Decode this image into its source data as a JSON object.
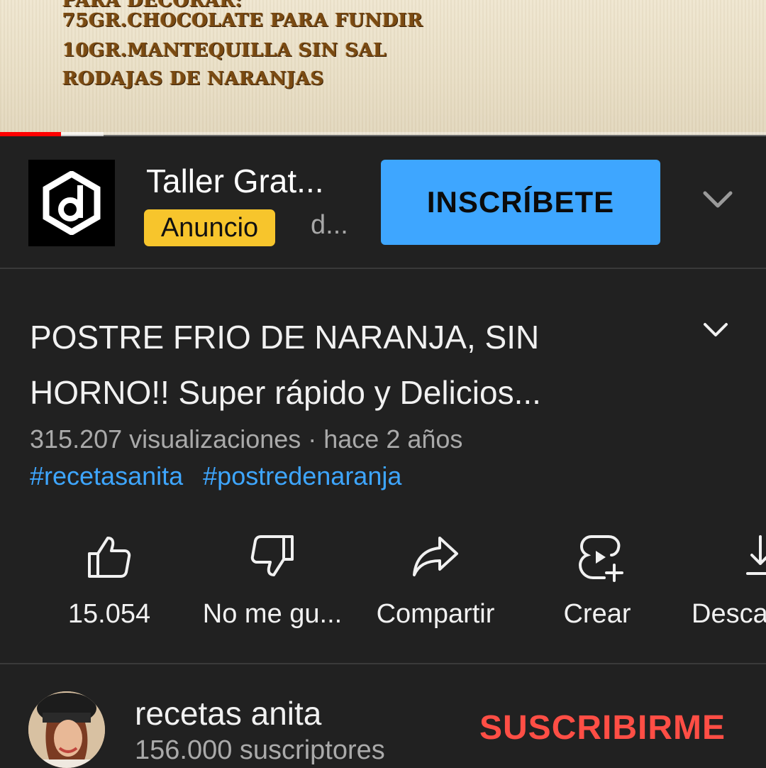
{
  "video": {
    "recipe_lines": [
      "75GR.CHOCOLATE PARA FUNDIR",
      "10GR.MANTEQUILLA SIN SAL",
      "RODAJAS DE NARANJAS"
    ],
    "progress_fraction": 0.08,
    "buffered_fraction": 0.135
  },
  "ad": {
    "title": "Taller Grat...",
    "badge": "Anuncio",
    "advertiser": "d...",
    "cta_label": "INSCRÍBETE",
    "logo_icon": "d-hexagon-logo",
    "expand_icon": "chevron-down-icon"
  },
  "video_info": {
    "title": "POSTRE FRIO DE NARANJA, SIN HORNO!! Super rápido y Delicios...",
    "meta": "315.207 visualizaciones · hace 2 años",
    "hashtags": [
      "#recetasanita",
      "#postredenaranja"
    ]
  },
  "actions": [
    {
      "label": "15.054",
      "icon": "thumbs-up-icon"
    },
    {
      "label": "No me gu...",
      "icon": "thumbs-down-icon"
    },
    {
      "label": "Compartir",
      "icon": "share-icon"
    },
    {
      "label": "Crear",
      "icon": "create-icon"
    },
    {
      "label": "Desca",
      "icon": "download-icon"
    }
  ],
  "channel": {
    "name": "recetas anita",
    "subscribers": "156.000 suscriptores",
    "subscribe_label": "SUSCRIBIRME"
  },
  "colors": {
    "background": "#212121",
    "accent_blue": "#3ea6ff",
    "badge_yellow": "#f7c52c",
    "subscribe_red": "#ff4e45",
    "progress_red": "#ff0000"
  }
}
